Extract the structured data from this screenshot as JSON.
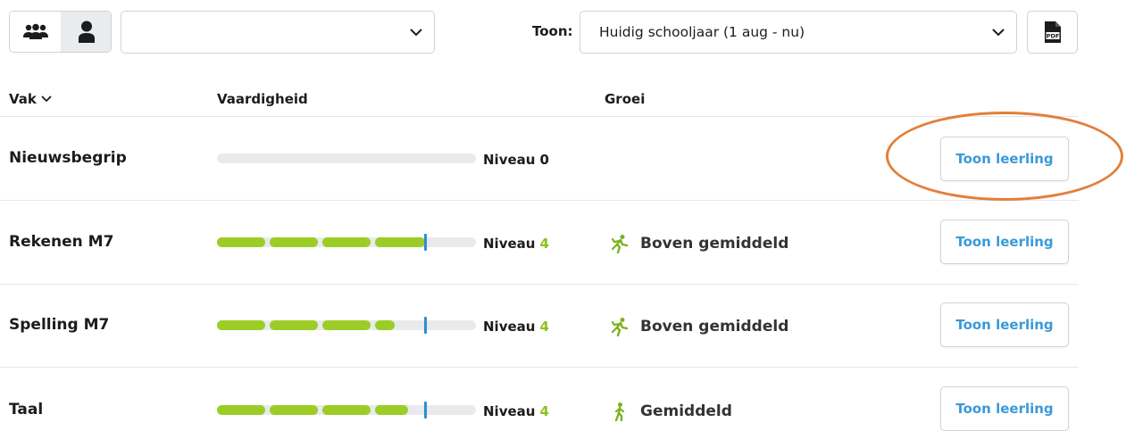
{
  "toolbar": {
    "view_group_icon": "group-icon",
    "view_student_icon": "person-icon",
    "student_select_value": "",
    "toon_label": "Toon:",
    "period_select_value": "Huidig schooljaar (1 aug - nu)",
    "pdf_icon": "pdf-icon"
  },
  "table": {
    "headers": {
      "vak": "Vak",
      "vaardigheid": "Vaardigheid",
      "groei": "Groei"
    },
    "rows": [
      {
        "vak": "Nieuwsbegrip",
        "niveau_label": "Niveau",
        "niveau": "0",
        "progress": 0,
        "groei": "",
        "button": "Toon leerling"
      },
      {
        "vak": "Rekenen M7",
        "niveau_label": "Niveau",
        "niveau": "4",
        "progress": 0.8,
        "groei": "Boven gemiddeld",
        "growth_icon": "running-figure-icon",
        "button": "Toon leerling"
      },
      {
        "vak": "Spelling M7",
        "niveau_label": "Niveau",
        "niveau": "4",
        "progress": 0.8,
        "groei": "Boven gemiddeld",
        "growth_icon": "running-figure-icon",
        "button": "Toon leerling"
      },
      {
        "vak": "Taal",
        "niveau_label": "Niveau",
        "niveau": "4",
        "progress": 0.8,
        "groei": "Gemiddeld",
        "growth_icon": "walking-figure-icon",
        "button": "Toon leerling"
      }
    ]
  },
  "colors": {
    "accent_blue": "#3a9ad9",
    "progress_green": "#9ccd27",
    "marker_blue": "#2e8ed3",
    "highlight_orange": "#e27f3a"
  }
}
